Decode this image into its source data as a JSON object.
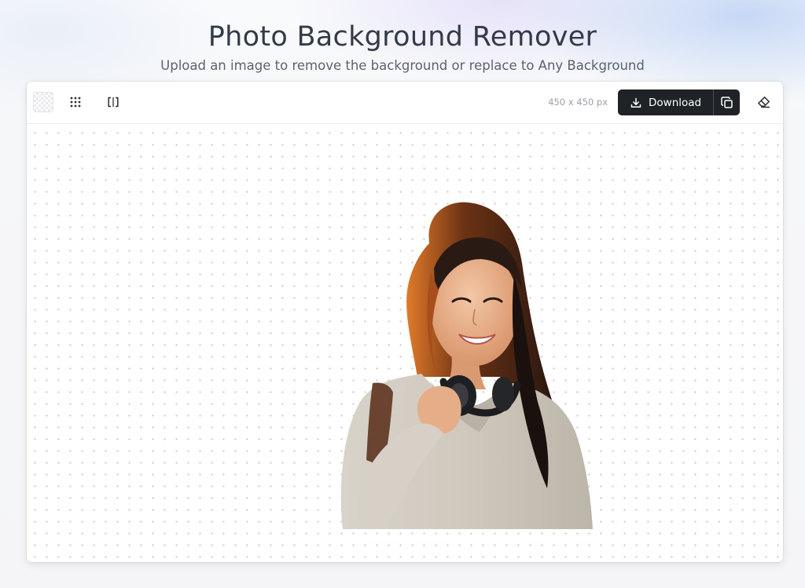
{
  "header": {
    "title": "Photo Background Remover",
    "subtitle": "Upload an image to remove the background or replace to Any Background"
  },
  "toolbar": {
    "tools": [
      {
        "name": "transparent-background",
        "icon": "checkerboard-icon"
      },
      {
        "name": "dot-grid",
        "icon": "grid-dots-icon"
      },
      {
        "name": "compare",
        "icon": "compare-brackets-icon"
      }
    ],
    "image_size": "450 x 450 px",
    "download_label": "Download",
    "download_icon": "download-icon",
    "copy_icon": "copy-icon",
    "eraser_icon": "eraser-icon"
  },
  "canvas": {
    "background": "transparent-dot-grid",
    "subject": "cutout-portrait"
  },
  "colors": {
    "title": "#343b48",
    "subtitle": "#5b6270",
    "download_button": "#1f2226",
    "canvas_dot": "#c4c7cc"
  }
}
